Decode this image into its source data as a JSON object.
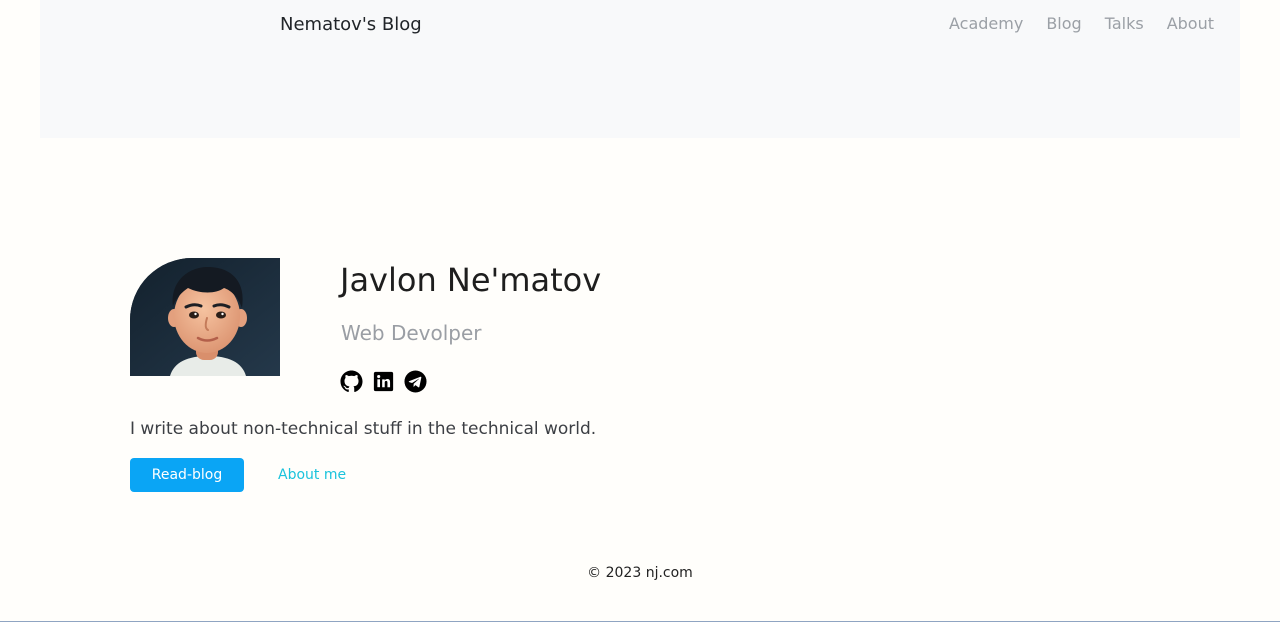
{
  "navbar": {
    "brand": "Nematov's Blog",
    "links": [
      "Academy",
      "Blog",
      "Talks",
      "About"
    ]
  },
  "profile": {
    "name": "Javlon Ne'matov",
    "role": "Web Devolper",
    "social_icons": [
      "github-icon",
      "linkedin-icon",
      "telegram-icon"
    ],
    "tagline": "I write about non-technical stuff in the technical world."
  },
  "actions": {
    "primary_label": "Read-blog",
    "secondary_label": "About me"
  },
  "footer": {
    "text": "© 2023 nj.com"
  },
  "colors": {
    "page_background": "#fffefb",
    "navbar_background": "#f8f9fa",
    "primary_button": "#0aa5f5",
    "link_accent": "#1bc3dc",
    "muted_text": "#9ba0a6"
  }
}
